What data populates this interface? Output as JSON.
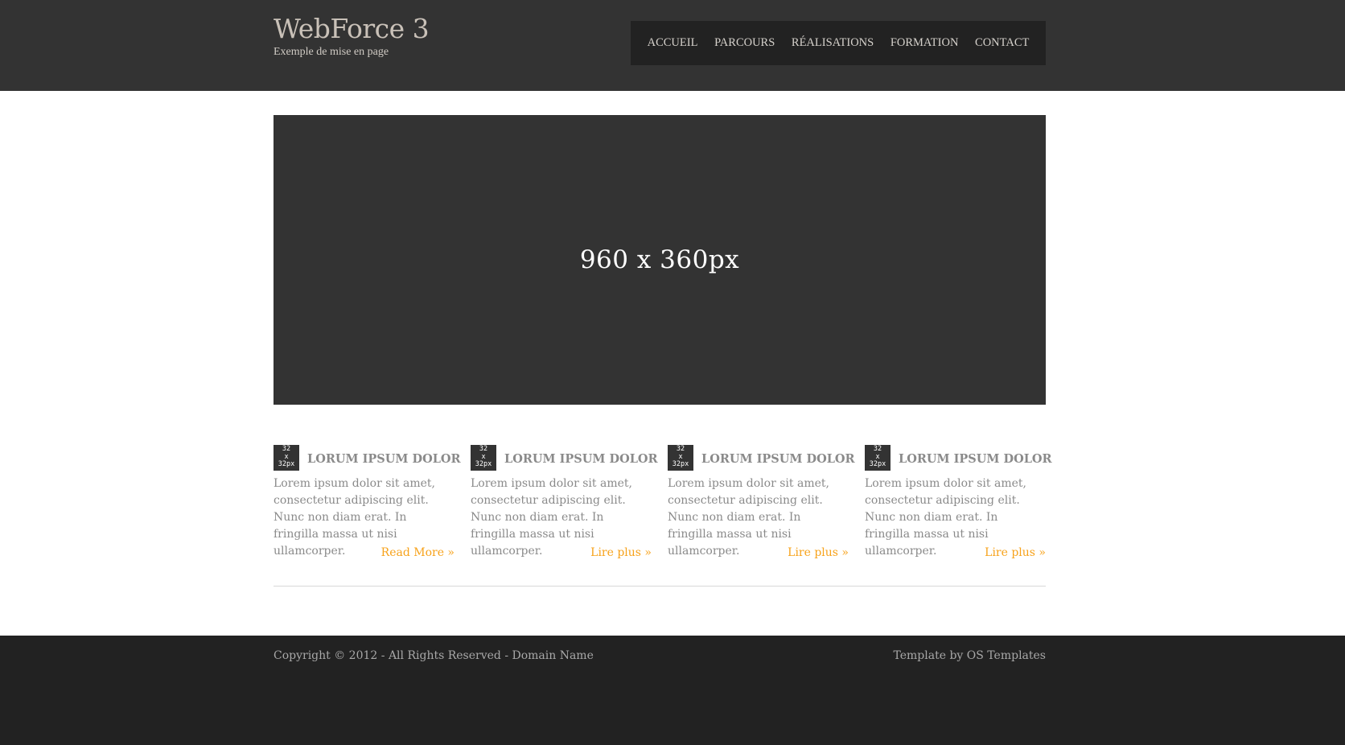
{
  "header": {
    "title": "WebForce 3",
    "tagline": "Exemple de mise en page",
    "nav": [
      {
        "label": "ACCUEIL"
      },
      {
        "label": "PARCOURS"
      },
      {
        "label": "RÉALISATIONS"
      },
      {
        "label": "FORMATION"
      },
      {
        "label": "CONTACT"
      }
    ]
  },
  "hero": {
    "placeholder": "960 x 360px"
  },
  "features": [
    {
      "thumb": [
        "32",
        "x",
        "32px"
      ],
      "title": "LORUM IPSUM DOLOR",
      "text": "Lorem ipsum dolor sit amet, consectetur adipiscing elit. Nunc non diam erat. In fringilla massa ut nisi ullamcorper.",
      "link": "Read More »"
    },
    {
      "thumb": [
        "32",
        "x",
        "32px"
      ],
      "title": "LORUM IPSUM DOLOR",
      "text": "Lorem ipsum dolor sit amet, consectetur adipiscing elit. Nunc non diam erat. In fringilla massa ut nisi ullamcorper.",
      "link": "Lire plus »"
    },
    {
      "thumb": [
        "32",
        "x",
        "32px"
      ],
      "title": "LORUM IPSUM DOLOR",
      "text": "Lorem ipsum dolor sit amet, consectetur adipiscing elit. Nunc non diam erat. In fringilla massa ut nisi ullamcorper.",
      "link": "Lire plus »"
    },
    {
      "thumb": [
        "32",
        "x",
        "32px"
      ],
      "title": "LORUM IPSUM DOLOR",
      "text": "Lorem ipsum dolor sit amet, consectetur adipiscing elit. Nunc non diam erat. In fringilla massa ut nisi ullamcorper.",
      "link": "Lire plus »"
    }
  ],
  "footer": {
    "copyright": "Copyright © 2012 - All Rights Reserved - Domain Name",
    "credit": "Template by OS Templates"
  },
  "colors": {
    "header_bg": "#333333",
    "nav_bg": "#222222",
    "footer_bg": "#222222",
    "accent": "#f7a21a",
    "body_text": "#8a8a8a"
  }
}
